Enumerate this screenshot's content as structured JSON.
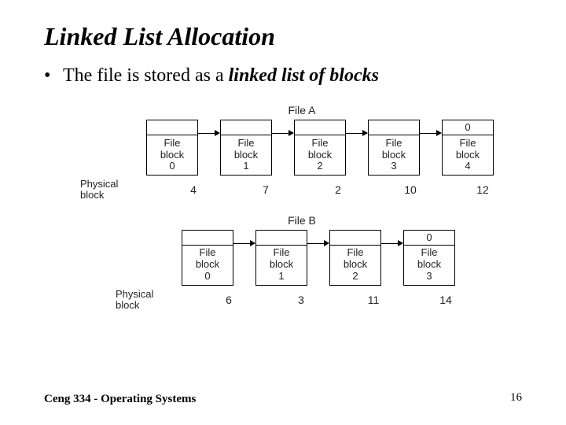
{
  "title": "Linked List Allocation",
  "bullet": {
    "dot": "•",
    "pre": "The file is stored as a ",
    "emph": "linked list of blocks"
  },
  "diagram": {
    "physLabel": "Physical\nblock",
    "fileA": {
      "label": "File A",
      "blocks": [
        {
          "ptr": "",
          "l1": "File",
          "l2": "block",
          "l3": "0",
          "phys": "4"
        },
        {
          "ptr": "",
          "l1": "File",
          "l2": "block",
          "l3": "1",
          "phys": "7"
        },
        {
          "ptr": "",
          "l1": "File",
          "l2": "block",
          "l3": "2",
          "phys": "2"
        },
        {
          "ptr": "",
          "l1": "File",
          "l2": "block",
          "l3": "3",
          "phys": "10"
        },
        {
          "ptr": "0",
          "l1": "File",
          "l2": "block",
          "l3": "4",
          "phys": "12"
        }
      ]
    },
    "fileB": {
      "label": "File B",
      "blocks": [
        {
          "ptr": "",
          "l1": "File",
          "l2": "block",
          "l3": "0",
          "phys": "6"
        },
        {
          "ptr": "",
          "l1": "File",
          "l2": "block",
          "l3": "1",
          "phys": "3"
        },
        {
          "ptr": "",
          "l1": "File",
          "l2": "block",
          "l3": "2",
          "phys": "11"
        },
        {
          "ptr": "0",
          "l1": "File",
          "l2": "block",
          "l3": "3",
          "phys": "14"
        }
      ]
    }
  },
  "footer": "Ceng 334 - Operating Systems",
  "page": "16"
}
